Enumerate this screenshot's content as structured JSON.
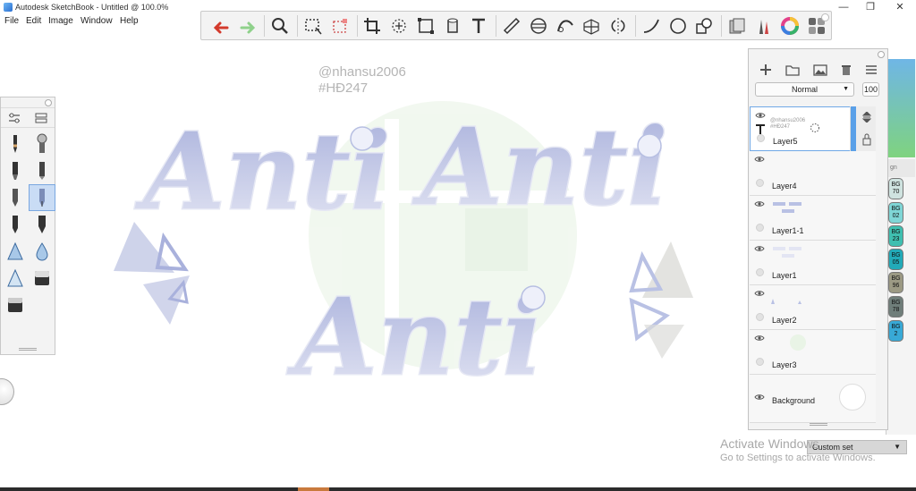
{
  "window": {
    "title": "Autodesk SketchBook - Untitled @ 100.0%",
    "controls": [
      "minimize",
      "maximize",
      "close"
    ]
  },
  "menu": {
    "items": [
      "File",
      "Edit",
      "Image",
      "Window",
      "Help"
    ]
  },
  "toolbar": {
    "tools": [
      "undo-icon",
      "redo-icon",
      "zoom-icon",
      "select-icon",
      "transform-select-icon",
      "crop-icon",
      "lasso-icon",
      "distort-icon",
      "fill-icon",
      "text-icon",
      "ruler-icon",
      "ellipse-guide-icon",
      "curve-guide-icon",
      "perspective-icon",
      "symmetry-icon",
      "stroke-icon",
      "ellipse-icon",
      "shape-icon",
      "copic-library-icon",
      "brush-library-icon",
      "color-wheel-icon",
      "panels-icon"
    ]
  },
  "canvas": {
    "watermark": [
      "@nhansu2006",
      "#HĐ247"
    ],
    "artwork_text": [
      "Anti",
      "Anti",
      "Anti"
    ]
  },
  "layers": {
    "blend_mode": "Normal",
    "opacity": "100",
    "items": [
      {
        "name": "Layer5",
        "active": true,
        "type": "text",
        "thumb_lines": [
          "@nhansu2006",
          "#HĐ247"
        ]
      },
      {
        "name": "Layer4",
        "active": false
      },
      {
        "name": "Layer1-1",
        "active": false
      },
      {
        "name": "Layer1",
        "active": false
      },
      {
        "name": "Layer2",
        "active": false
      },
      {
        "name": "Layer3",
        "active": false
      },
      {
        "name": "Background",
        "active": false
      }
    ]
  },
  "copic": {
    "swatches": [
      {
        "code": "BG\n70",
        "color": "#cfe3e0"
      },
      {
        "code": "BG\n02",
        "color": "#7fd6d6"
      },
      {
        "code": "BG\n23",
        "color": "#3fbfb0"
      },
      {
        "code": "BG\n05",
        "color": "#22aab8"
      },
      {
        "code": "BG\n96",
        "color": "#9c9a84"
      },
      {
        "code": "BG\n78",
        "color": "#6f7e7a"
      },
      {
        "code": "BG\n2",
        "color": "#38a9d6"
      }
    ],
    "set_name": "Custom set"
  },
  "activation": {
    "line1": "Activate Windows",
    "line2": "Go to Settings to activate Windows."
  },
  "colors": {
    "lettering": "#b9c1e4",
    "accent": "#5aa0e8",
    "panel": "#f3f3f3"
  }
}
